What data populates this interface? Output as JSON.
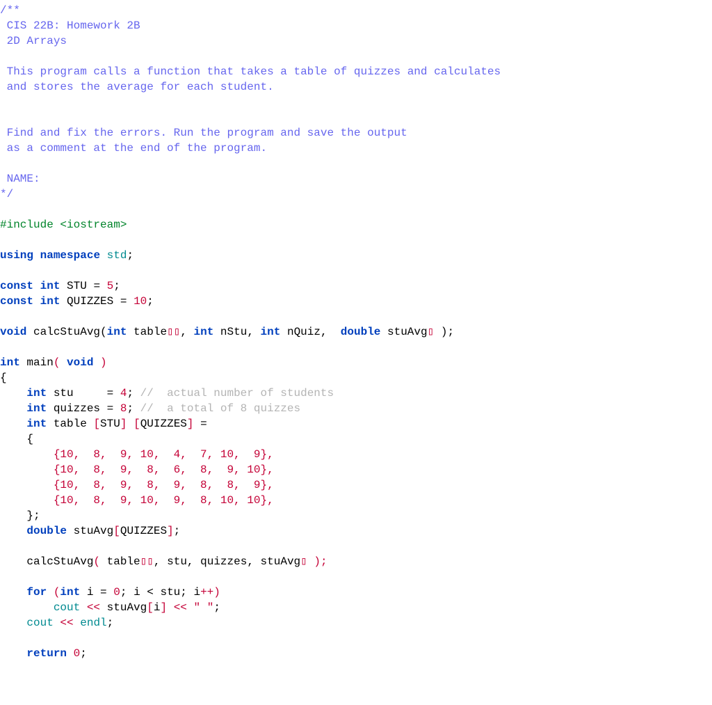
{
  "doc_comment": {
    "open": "/**",
    "l1": " CIS 22B: Homework 2B",
    "l2": " 2D Arrays",
    "blank1": "",
    "l3": " This program calls a function that takes a table of quizzes and calculates",
    "l4": " and stores the average for each student.",
    "blank2": "",
    "blank3": "",
    "l5": " Find and fix the errors. Run the program and save the output",
    "l6": " as a comment at the end of the program.",
    "blank4": "",
    "l7": " NAME:",
    "close": "*/"
  },
  "include": {
    "hash": "#include ",
    "hdr": "<iostream>"
  },
  "using": {
    "kw_using": "using",
    "kw_namespace": "namespace",
    "ident": "std",
    "semi": ";"
  },
  "const1": {
    "kw_const": "const",
    "kw_int": "int",
    "name": "STU",
    "eq": " = ",
    "val": "5",
    "semi": ";"
  },
  "const2": {
    "kw_const": "const",
    "kw_int": "int",
    "name": "QUIZZES",
    "eq": " = ",
    "val": "10",
    "semi": ";"
  },
  "proto": {
    "kw_void": "void",
    "fn": " calcStuAvg(",
    "kw_int1": "int",
    "arg1": " table",
    "box2": "▯▯",
    "comma1": ", ",
    "kw_int2": "int",
    "arg2": " nStu, ",
    "kw_int3": "int",
    "arg3": " nQuiz,  ",
    "kw_double": "double",
    "arg4": " stuAvg",
    "box1": "▯",
    "close": " );"
  },
  "main_sig": {
    "kw_int": "int",
    "name": " main",
    "lp": "( ",
    "kw_void": "void",
    "rp": " )"
  },
  "brace_open": "{",
  "decl_stu": {
    "indent": "    ",
    "kw_int": "int",
    "name": " stu     ",
    "eq": "= ",
    "val": "4",
    "semi": "; ",
    "cmt": "//  actual number of students"
  },
  "decl_quizzes": {
    "indent": "    ",
    "kw_int": "int",
    "name": " quizzes ",
    "eq": "= ",
    "val": "8",
    "semi": "; ",
    "cmt": "//  a total of 8 quizzes"
  },
  "decl_table": {
    "indent": "    ",
    "kw_int": "int",
    "name": " table ",
    "lb1": "[",
    "dim1": "STU",
    "rb1": "]",
    "sp": " ",
    "lb2": "[",
    "dim2": "QUIZZES",
    "rb2": "]",
    "eq": " ="
  },
  "arr_open": {
    "indent": "    ",
    "brace": "{"
  },
  "row1": "        {10,  8,  9, 10,  4,  7, 10,  9},",
  "row2": "        {10,  8,  9,  8,  6,  8,  9, 10},",
  "row3": "        {10,  8,  9,  8,  9,  8,  8,  9},",
  "row4": "        {10,  8,  9, 10,  9,  8, 10, 10},",
  "arr_close": {
    "indent": "    ",
    "text": "};"
  },
  "decl_stuavg": {
    "indent": "    ",
    "kw_double": "double",
    "name": " stuAvg",
    "lb": "[",
    "dim": "QUIZZES",
    "rb": "]",
    "semi": ";"
  },
  "call": {
    "indent": "    ",
    "fn": "calcStuAvg",
    "lp": "( ",
    "a1": "table",
    "box2": "▯▯",
    "c1": ", stu, quizzes, stuAvg",
    "box1": "▯",
    "rp": " );"
  },
  "for_line": {
    "indent": "    ",
    "kw_for": "for",
    "lp": " (",
    "kw_int": "int",
    "init": " i ",
    "eq": "= ",
    "zero": "0",
    "semi1": "; i ",
    "lt": "< ",
    "limit": "stu; i",
    "inc": "++",
    "rp": ")"
  },
  "cout1": {
    "indent": "        ",
    "cout": "cout ",
    "lsh1": "<< ",
    "expr": "stuAvg",
    "lb": "[",
    "idx": "i",
    "rb": "]",
    "sp": " ",
    "lsh2": "<< ",
    "str": "\" \"",
    "semi": ";"
  },
  "cout2": {
    "indent": "    ",
    "cout": "cout ",
    "lsh": "<< ",
    "endl": "endl",
    "semi": ";"
  },
  "ret": {
    "indent": "    ",
    "kw_return": "return",
    "sp": " ",
    "val": "0",
    "semi": ";"
  }
}
